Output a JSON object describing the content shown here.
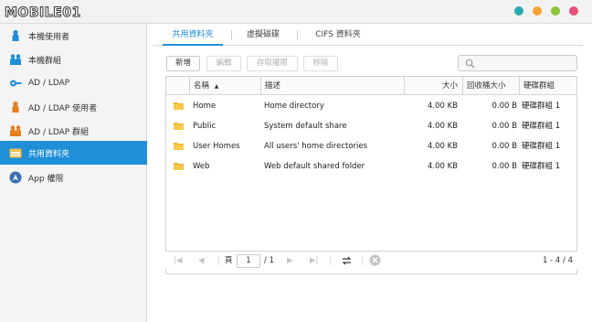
{
  "app": {
    "logo_text": "MOBILE01",
    "window_dots": [
      "#2aa9b0",
      "#f4a534",
      "#8fc33a",
      "#e94e77"
    ]
  },
  "sidebar": {
    "items": [
      {
        "label": "本機使用者",
        "icon": "single-user-icon",
        "color": "#1f8fd8"
      },
      {
        "label": "本機群組",
        "icon": "user-group-icon",
        "color": "#1f8fd8"
      },
      {
        "label": "AD / LDAP",
        "icon": "key-icon",
        "color": "#1f8fd8"
      },
      {
        "label": "AD / LDAP 使用者",
        "icon": "single-user-icon",
        "color": "#e67e22"
      },
      {
        "label": "AD / LDAP 群組",
        "icon": "user-group-icon",
        "color": "#e67e22"
      },
      {
        "label": "共用資料夾",
        "icon": "shared-folder-icon",
        "color": "#f2c14e",
        "active": true
      },
      {
        "label": "App 權限",
        "icon": "app-permission-icon",
        "color": "#3c6fb0"
      }
    ]
  },
  "tabs": [
    {
      "label": "共用資料夾",
      "active": true
    },
    {
      "label": "虛擬磁碟"
    },
    {
      "label": "CIFS 資料夾"
    }
  ],
  "toolbar": {
    "add": "新增",
    "edit": "編輯",
    "permissions": "存取權限",
    "remove": "移除"
  },
  "table": {
    "headers": {
      "name": "名稱",
      "desc": "描述",
      "size": "大小",
      "recycle": "回收桶大小",
      "group": "硬碟群組"
    },
    "rows": [
      {
        "name": "Home",
        "desc": "Home directory",
        "size": "4.00 KB",
        "recycle": "0.00 B",
        "group": "硬碟群組 1"
      },
      {
        "name": "Public",
        "desc": "System default share",
        "size": "4.00 KB",
        "recycle": "0.00 B",
        "group": "硬碟群組 1"
      },
      {
        "name": "User Homes",
        "desc": "All users' home directories",
        "size": "4.00 KB",
        "recycle": "0.00 B",
        "group": "硬碟群組 1"
      },
      {
        "name": "Web",
        "desc": "Web default shared folder",
        "size": "4.00 KB",
        "recycle": "0.00 B",
        "group": "硬碟群組 1"
      }
    ]
  },
  "pager": {
    "page_label": "頁",
    "current_page": "1",
    "total_pages": "/ 1",
    "range": "1 - 4 / 4"
  }
}
